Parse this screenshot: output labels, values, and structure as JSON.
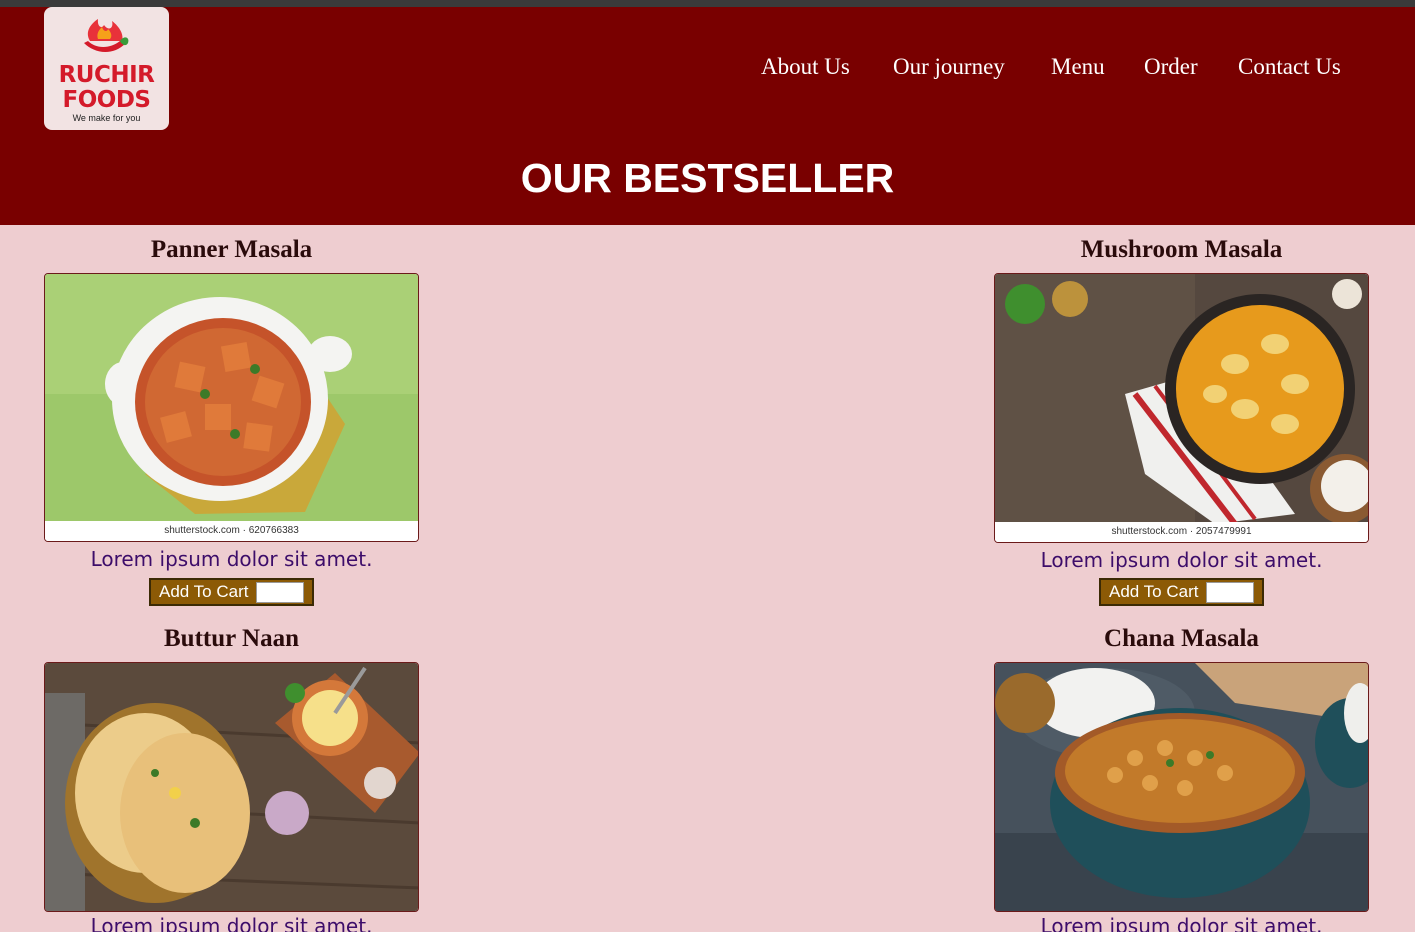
{
  "brand": {
    "line1": "RUCHIR",
    "line2": "FOODS",
    "tagline": "We make for you"
  },
  "nav": [
    {
      "label": "About Us"
    },
    {
      "label": "Our journey"
    },
    {
      "label": "Menu"
    },
    {
      "label": "Order"
    },
    {
      "label": "Contact Us"
    }
  ],
  "page_title": "OUR BESTSELLER",
  "products": [
    {
      "name": "Panner Masala",
      "description": "Lorem ipsum dolor sit amet.",
      "credit": "shutterstock.com · 620766383",
      "button": "Add To Cart"
    },
    {
      "name": "Mushroom Masala",
      "description": "Lorem ipsum dolor sit amet.",
      "credit": "shutterstock.com · 2057479991",
      "button": "Add To Cart"
    },
    {
      "name": "Buttur Naan",
      "description": "Lorem ipsum dolor sit amet."
    },
    {
      "name": "Chana Masala",
      "description": "Lorem ipsum dolor sit amet."
    }
  ],
  "colors": {
    "header_bg": "#790000",
    "page_bg": "#eecdd0",
    "button_bg": "#8c5a06",
    "description_text": "#3d0d6a"
  }
}
